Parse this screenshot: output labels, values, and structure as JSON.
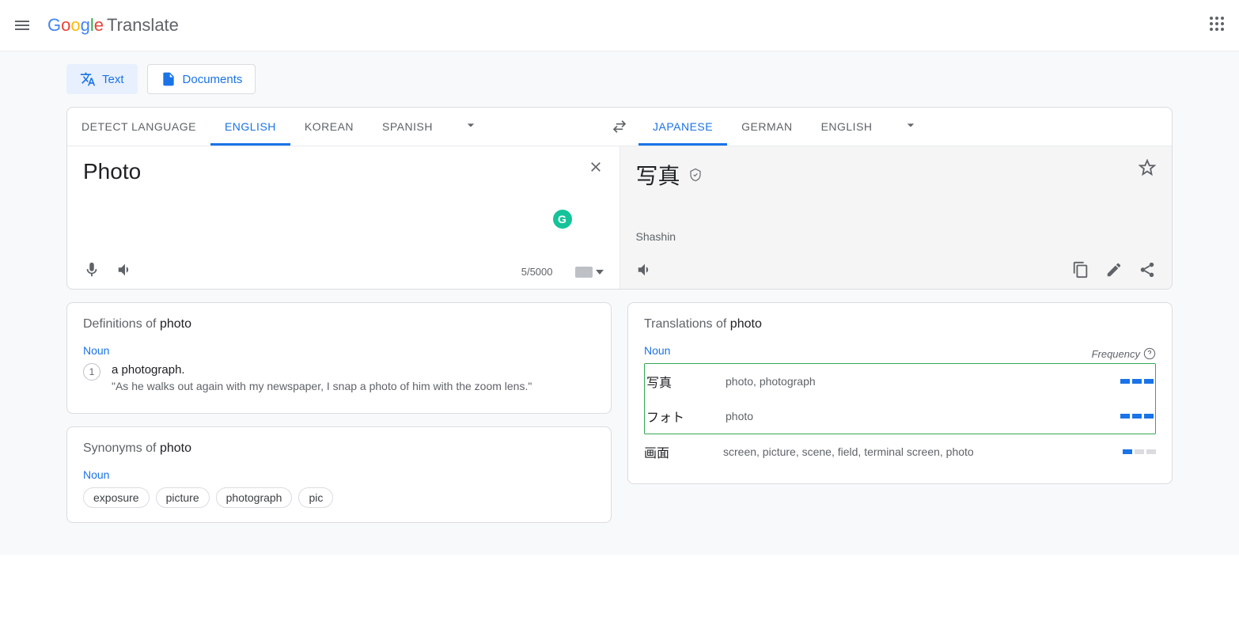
{
  "header": {
    "app_name": "Translate"
  },
  "modes": {
    "text": "Text",
    "documents": "Documents"
  },
  "source_langs": [
    "DETECT LANGUAGE",
    "ENGLISH",
    "KOREAN",
    "SPANISH"
  ],
  "source_active_index": 1,
  "target_langs": [
    "JAPANESE",
    "GERMAN",
    "ENGLISH"
  ],
  "target_active_index": 0,
  "input": {
    "text": "Photo",
    "charcount": "5/5000"
  },
  "output": {
    "text": "写真",
    "translit": "Shashin"
  },
  "definitions": {
    "title_prefix": "Definitions of ",
    "word": "photo",
    "pos": "Noun",
    "items": [
      {
        "num": "1",
        "def": "a photograph.",
        "example": "\"As he walks out again with my newspaper, I snap a photo of him with the zoom lens.\""
      }
    ]
  },
  "synonyms": {
    "title_prefix": "Synonyms of ",
    "word": "photo",
    "pos": "Noun",
    "chips": [
      "exposure",
      "picture",
      "photograph",
      "pic"
    ]
  },
  "translations": {
    "title_prefix": "Translations of ",
    "word": "photo",
    "pos": "Noun",
    "freq_label": "Frequency",
    "items": [
      {
        "word": "写真",
        "meanings": "photo, photograph",
        "freq": 3,
        "hl": true
      },
      {
        "word": "フォト",
        "meanings": "photo",
        "freq": 3,
        "hl": true
      },
      {
        "word": "画面",
        "meanings": "screen, picture, scene, field, terminal screen, photo",
        "freq": 1,
        "hl": false
      }
    ]
  }
}
